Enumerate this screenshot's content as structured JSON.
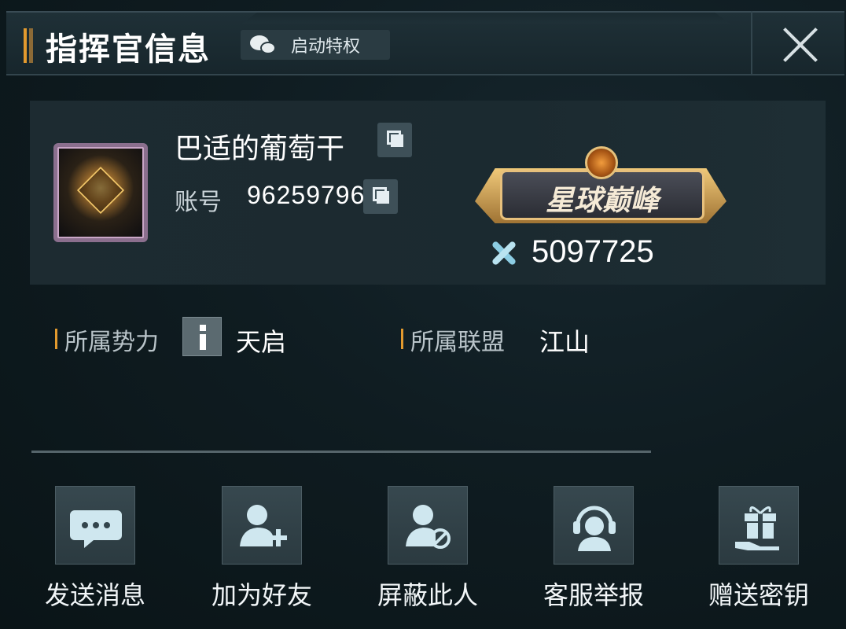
{
  "header": {
    "title": "指挥官信息",
    "privilege_label": "启动特权"
  },
  "profile": {
    "nickname": "巴适的葡萄干",
    "account_label": "账号",
    "account_id": "96259796",
    "rank_title": "星球巅峰",
    "power": "5097725"
  },
  "info": {
    "faction_label": "所属势力",
    "faction_value": "天启",
    "alliance_label": "所属联盟",
    "alliance_value": "江山"
  },
  "actions": [
    {
      "label": "发送消息",
      "icon": "message-icon"
    },
    {
      "label": "加为好友",
      "icon": "add-friend-icon"
    },
    {
      "label": "屏蔽此人",
      "icon": "block-user-icon"
    },
    {
      "label": "客服举报",
      "icon": "support-headset-icon"
    },
    {
      "label": "赠送密钥",
      "icon": "gift-icon"
    }
  ],
  "colors": {
    "accent": "#e39a2e",
    "background": "#0f1c21",
    "tile": "#37484f",
    "icon": "#cfe7ef"
  }
}
